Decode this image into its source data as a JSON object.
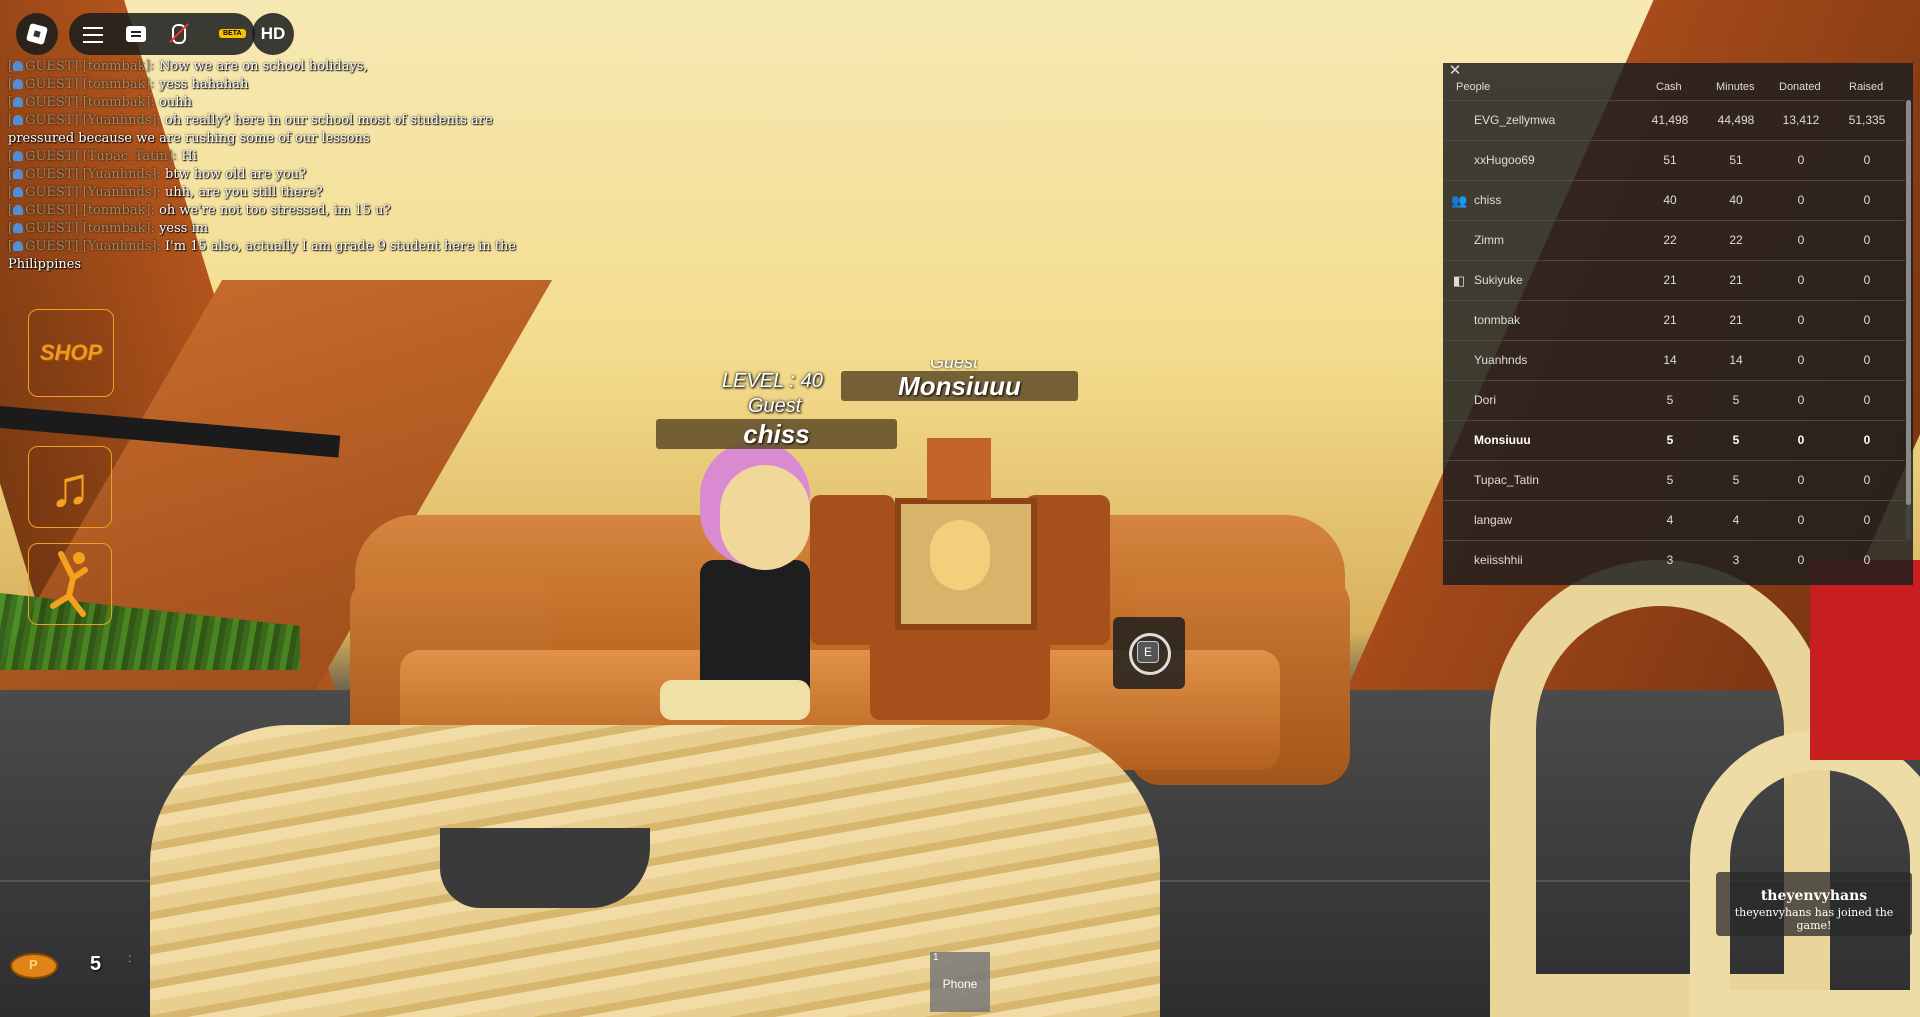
{
  "topbar": {
    "beta_label": "BETA",
    "hd_label": "HD"
  },
  "chat": {
    "messages": [
      {
        "tag": "GUEST] [tonmbak]:",
        "text": "Now we are on school holidays,"
      },
      {
        "tag": "GUEST] [tonmbak]:",
        "text": "yess hahahah"
      },
      {
        "tag": "GUEST] [tonmbak]:",
        "text": "ouhh"
      },
      {
        "tag": "GUEST] [Yuanhnds]:",
        "text": "oh really? here in our school most of students are pressured because we are rushing some of our lessons"
      },
      {
        "tag": "GUEST] [Tupac_Tatin]:",
        "text": "Hi"
      },
      {
        "tag": "GUEST] [Yuanhnds]:",
        "text": "btw how old are you?"
      },
      {
        "tag": "GUEST] [Yuanhnds]:",
        "text": "uhh, are you still there?"
      },
      {
        "tag": "GUEST] [tonmbak]:",
        "text": "oh we're not too stressed, im 15 u?"
      },
      {
        "tag": "GUEST] [tonmbak]:",
        "text": "yess im"
      },
      {
        "tag": "GUEST] [Yuanhnds]:",
        "text": "I'm 15 also, actually I am grade 9 student here in the Philippines"
      }
    ]
  },
  "side": {
    "shop_label": "SHOP",
    "music_icon": "music-note-icon",
    "dance_icon": "dance-icon"
  },
  "billboards": {
    "level": "LEVEL : 40",
    "guest": "Guest",
    "guest2": "Guest",
    "player1": "chiss",
    "player2": "Monsiuuu",
    "prompt_key": "E"
  },
  "leaderboard": {
    "columns": [
      "People",
      "Cash",
      "Minutes",
      "Donated",
      "Raised"
    ],
    "rows": [
      {
        "icon": "",
        "name": "EVG_zellymwa",
        "cash": "41,498",
        "minutes": "44,498",
        "donated": "13,412",
        "raised": "51,335"
      },
      {
        "icon": "",
        "name": "xxHugoo69",
        "cash": "51",
        "minutes": "51",
        "donated": "0",
        "raised": "0"
      },
      {
        "icon": "friends-icon",
        "name": "chiss",
        "cash": "40",
        "minutes": "40",
        "donated": "0",
        "raised": "0"
      },
      {
        "icon": "",
        "name": "Zimm",
        "cash": "22",
        "minutes": "22",
        "donated": "0",
        "raised": "0"
      },
      {
        "icon": "premium-icon",
        "name": "Sukiyuke",
        "cash": "21",
        "minutes": "21",
        "donated": "0",
        "raised": "0"
      },
      {
        "icon": "",
        "name": "tonmbak",
        "cash": "21",
        "minutes": "21",
        "donated": "0",
        "raised": "0"
      },
      {
        "icon": "",
        "name": "Yuanhnds",
        "cash": "14",
        "minutes": "14",
        "donated": "0",
        "raised": "0"
      },
      {
        "icon": "",
        "name": "Dori",
        "cash": "5",
        "minutes": "5",
        "donated": "0",
        "raised": "0"
      },
      {
        "icon": "",
        "name": "Monsiuuu",
        "cash": "5",
        "minutes": "5",
        "donated": "0",
        "raised": "0",
        "me": true
      },
      {
        "icon": "",
        "name": "Tupac_Tatin",
        "cash": "5",
        "minutes": "5",
        "donated": "0",
        "raised": "0"
      },
      {
        "icon": "",
        "name": "langaw",
        "cash": "4",
        "minutes": "4",
        "donated": "0",
        "raised": "0"
      },
      {
        "icon": "",
        "name": "keiisshhii",
        "cash": "3",
        "minutes": "3",
        "donated": "0",
        "raised": "0"
      }
    ]
  },
  "hud": {
    "cash_value": "5",
    "dots": ":",
    "hotbar_slot_number": "1",
    "hotbar_slot_label": "Phone"
  },
  "notification": {
    "title": "theyenvyhans",
    "subtitle": "theyenvyhans has joined the game!"
  }
}
